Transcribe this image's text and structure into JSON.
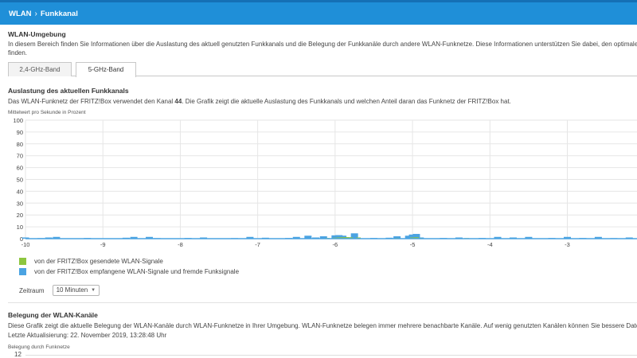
{
  "header": {
    "crumb_root": "WLAN",
    "crumb_sep": "›",
    "crumb_page": "Funkkanal"
  },
  "section1": {
    "title": "WLAN-Umgebung",
    "desc_line1": "In diesem Bereich finden Sie Informationen über die Auslastung des aktuell genutzten Funkkanals und die Belegung der Funkkanäle durch andere WLAN-Funknetze. Diese Informationen unterstützen Sie dabei, den optimalen Fu",
    "desc_line2": "finden."
  },
  "tabs": [
    {
      "label": "2,4-GHz-Band",
      "active": false
    },
    {
      "label": "5-GHz-Band",
      "active": true
    }
  ],
  "section2": {
    "title": "Auslastung des aktuellen Funkkanals",
    "desc_prefix": "Das WLAN-Funknetz der FRITZ!Box verwendet den Kanal ",
    "desc_channel": "44",
    "desc_suffix": ". Die Grafik zeigt die aktuelle Auslastung des Funkkanals und welchen Anteil daran das Funknetz der FRITZ!Box hat."
  },
  "chart_data": {
    "type": "area",
    "title": "",
    "ylabel": "Mittelwert pro Sekunde in Prozent",
    "xlabel": "",
    "x_ticks": [
      -10,
      -9,
      -8,
      -7,
      -6,
      -5,
      -4,
      -3
    ],
    "y_ticks": [
      0,
      10,
      20,
      30,
      40,
      50,
      60,
      70,
      80,
      90,
      100
    ],
    "xlim": [
      -10,
      -2.1
    ],
    "ylim": [
      0,
      100
    ],
    "grid": true,
    "legend_placement": "bottom-left",
    "series": [
      {
        "name": "von der FRITZ!Box gesendete WLAN-Signale",
        "color": "#8dc63f",
        "x": [
          -6.1,
          -6.0,
          -5.95,
          -5.9,
          -5.85,
          -5.8,
          -5.7,
          -5.3,
          -5.2,
          -5.0,
          -4.95,
          -4.9,
          -4.3,
          -3.5
        ],
        "y": [
          0.6,
          0.8,
          1.0,
          1.2,
          1.3,
          1.1,
          1.0,
          0.3,
          0.6,
          1.0,
          1.2,
          0.5,
          0.5,
          0.3
        ]
      },
      {
        "name": "von der FRITZ!Box empfangene WLAN-Signale und fremde Funksignale",
        "color": "#4ba3e2",
        "x": [
          -10.0,
          -9.8,
          -9.7,
          -9.6,
          -9.2,
          -8.7,
          -8.6,
          -8.4,
          -8.3,
          -7.9,
          -7.7,
          -7.3,
          -7.1,
          -6.9,
          -6.6,
          -6.5,
          -6.35,
          -6.25,
          -6.15,
          -6.0,
          -5.95,
          -5.9,
          -5.82,
          -5.75,
          -5.5,
          -5.3,
          -5.2,
          -5.05,
          -5.0,
          -4.95,
          -4.9,
          -4.6,
          -4.4,
          -4.1,
          -3.9,
          -3.7,
          -3.5,
          -3.2,
          -3.0,
          -2.8,
          -2.6,
          -2.4,
          -2.2
        ],
        "y": [
          1.0,
          0.5,
          1.0,
          1.5,
          0.6,
          0.8,
          1.5,
          1.5,
          0.5,
          0.6,
          1.0,
          0.5,
          1.5,
          0.8,
          0.6,
          1.5,
          2.5,
          1.0,
          2.0,
          2.8,
          3.0,
          2.5,
          1.2,
          4.5,
          0.6,
          0.8,
          2.0,
          2.5,
          3.5,
          4.0,
          1.0,
          0.6,
          1.0,
          0.6,
          1.5,
          1.0,
          1.5,
          0.6,
          1.5,
          0.6,
          1.5,
          0.5,
          1.0
        ]
      }
    ]
  },
  "legend": [
    {
      "label": "von der FRITZ!Box gesendete WLAN-Signale",
      "color": "#8dc63f"
    },
    {
      "label": "von der FRITZ!Box empfangene WLAN-Signale und fremde Funksignale",
      "color": "#4ba3e2"
    }
  ],
  "zeitraum": {
    "label": "Zeitraum",
    "selected": "10 Minuten"
  },
  "section3": {
    "title": "Belegung der WLAN-Kanäle",
    "desc": "Diese Grafik zeigt die aktuelle Belegung der WLAN-Kanäle durch WLAN-Funknetze in Ihrer Umgebung. WLAN-Funknetze belegen immer mehrere benachbarte Kanäle. Auf wenig genutzten Kanälen können Sie bessere Datendurc",
    "updated": "Letzte Aktualisierung: 22. November 2019, 13:28:48 Uhr",
    "chart_label": "Belegung durch Funknetze",
    "first_tick": "12"
  }
}
